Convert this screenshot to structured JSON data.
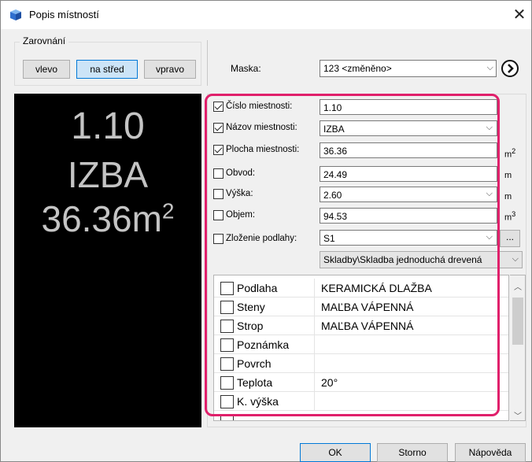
{
  "window": {
    "title": "Popis místností",
    "close_glyph": "✕"
  },
  "alignment": {
    "legend": "Zarovnání",
    "buttons": [
      {
        "label": "vlevo"
      },
      {
        "label": "na střed"
      },
      {
        "label": "vpravo"
      }
    ],
    "selected": "na střed"
  },
  "mask": {
    "label": "Maska:",
    "value": "123 <změněno>",
    "go_icon": "arrow-right-circle-icon"
  },
  "preview": {
    "line1": "1.10",
    "line2": "IZBA",
    "line3": "36.36m",
    "line3_sup": "2"
  },
  "properties": [
    {
      "label": "Číslo miestnosti:",
      "checked": true,
      "value": "1.10",
      "unit": "",
      "dropdown": false
    },
    {
      "label": "Názov miestnosti:",
      "checked": true,
      "value": "IZBA",
      "unit": "",
      "dropdown": true
    },
    {
      "label": "Plocha miestnosti:",
      "checked": true,
      "value": "36.36",
      "unit": "m",
      "unit_sup": "2",
      "dropdown": false
    },
    {
      "label": "Obvod:",
      "checked": false,
      "value": "24.49",
      "unit": "m",
      "dropdown": false
    },
    {
      "label": "Výška:",
      "checked": false,
      "value": "2.60",
      "unit": "m",
      "dropdown": true
    },
    {
      "label": "Objem:",
      "checked": false,
      "value": "94.53",
      "unit": "m",
      "unit_sup": "3",
      "dropdown": false
    },
    {
      "label": "Zloženie podlahy:",
      "checked": false,
      "value": "S1",
      "unit": "",
      "dropdown": true
    }
  ],
  "browse_label": "...",
  "floor_path": "Skladby\\Skladba jednoduchá drevená",
  "grid": {
    "rows": [
      {
        "name": "Podlaha",
        "value": "KERAMICKÁ DLAŽBA"
      },
      {
        "name": "Steny",
        "value": "MAĽBA VÁPENNÁ"
      },
      {
        "name": "Strop",
        "value": "MAĽBA VÁPENNÁ"
      },
      {
        "name": "Poznámka",
        "value": ""
      },
      {
        "name": "Povrch",
        "value": ""
      },
      {
        "name": "Teplota",
        "value": "20°"
      },
      {
        "name": "K. výška",
        "value": ""
      }
    ]
  },
  "footer": {
    "ok": "OK",
    "storno": "Storno",
    "help": "Nápověda"
  },
  "colors": {
    "highlight": "#e0206b",
    "accent": "#0078d7",
    "preview_bg": "#000000"
  }
}
